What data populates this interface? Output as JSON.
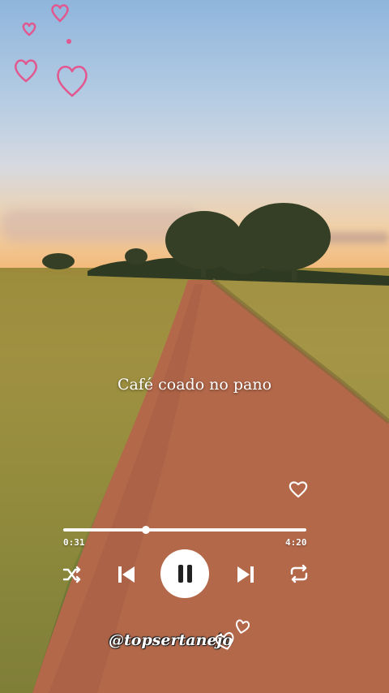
{
  "song": {
    "title": "Café coado no pano"
  },
  "player": {
    "elapsed": "0:31",
    "total": "4:20",
    "progress": 0.34
  },
  "watermark": {
    "handle": "@topsertanejo"
  },
  "icons": {
    "favorite": "heart-outline-icon",
    "shuffle": "shuffle-icon",
    "previous": "skip-previous-icon",
    "play_pause": "pause-icon",
    "next": "skip-next-icon",
    "repeat": "repeat-icon"
  },
  "colors": {
    "controls": "#ffffff",
    "hearts": "#e2578f"
  }
}
